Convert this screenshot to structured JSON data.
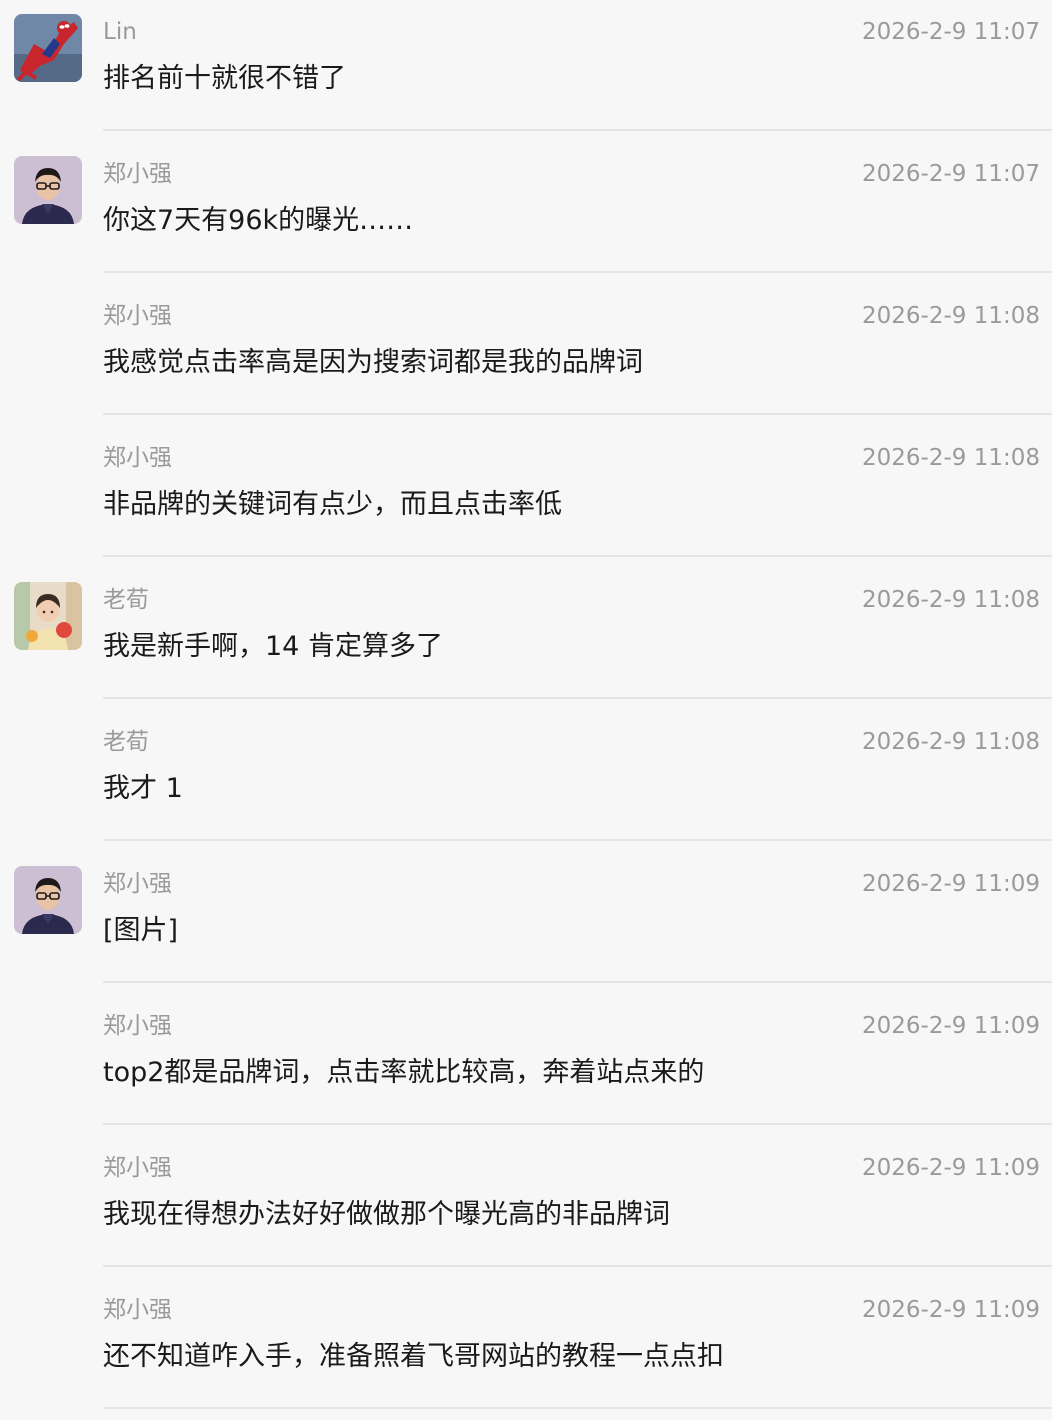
{
  "messages": [
    {
      "sender": "Lin",
      "time": "2026-2-9 11:07",
      "text": "排名前十就很不错了",
      "avatar": "spiderman-avatar"
    },
    {
      "sender": "郑小强",
      "time": "2026-2-9 11:07",
      "text": "你这7天有96k的曝光……",
      "avatar": "man-glasses-avatar"
    },
    {
      "sender": "郑小强",
      "time": "2026-2-9 11:08",
      "text": "我感觉点击率高是因为搜索词都是我的品牌词",
      "avatar": ""
    },
    {
      "sender": "郑小强",
      "time": "2026-2-9 11:08",
      "text": "非品牌的关键词有点少，而且点击率低",
      "avatar": ""
    },
    {
      "sender": "老荀",
      "time": "2026-2-9 11:08",
      "text": "我是新手啊，14 肯定算多了",
      "avatar": "girl-photo-avatar"
    },
    {
      "sender": "老荀",
      "time": "2026-2-9 11:08",
      "text": "我才 1",
      "avatar": ""
    },
    {
      "sender": "郑小强",
      "time": "2026-2-9 11:09",
      "text": "[图片]",
      "avatar": "man-glasses-avatar"
    },
    {
      "sender": "郑小强",
      "time": "2026-2-9 11:09",
      "text": "top2都是品牌词，点击率就比较高，奔着站点来的",
      "avatar": ""
    },
    {
      "sender": "郑小强",
      "time": "2026-2-9 11:09",
      "text": "我现在得想办法好好做做那个曝光高的非品牌词",
      "avatar": ""
    },
    {
      "sender": "郑小强",
      "time": "2026-2-9 11:09",
      "text": "还不知道咋入手，准备照着飞哥网站的教程一点点扣",
      "avatar": ""
    }
  ]
}
